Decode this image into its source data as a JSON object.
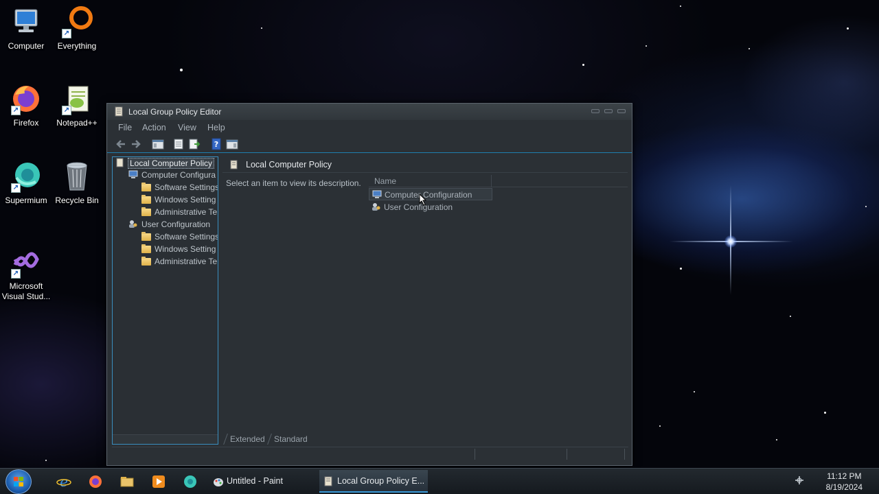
{
  "desktop": {
    "icons": [
      {
        "label": "Computer",
        "icon": "computer-icon"
      },
      {
        "label": "Everything",
        "icon": "everything-search-icon"
      },
      {
        "label": "Firefox",
        "icon": "firefox-icon"
      },
      {
        "label": "Notepad++",
        "icon": "notepadpp-icon"
      },
      {
        "label": "Supermium",
        "icon": "supermium-icon"
      },
      {
        "label": "Recycle Bin",
        "icon": "recycle-bin-icon"
      },
      {
        "label": "Microsoft Visual Stud...",
        "label_line1": "Microsoft",
        "label_line2": "Visual Stud...",
        "icon": "visual-studio-icon"
      }
    ]
  },
  "window": {
    "title": "Local Group Policy Editor",
    "menu": [
      "File",
      "Action",
      "View",
      "Help"
    ],
    "toolbar": [
      "back-arrow-icon",
      "forward-arrow-icon",
      "show-hide-console-tree-icon",
      "properties-icon",
      "export-list-icon",
      "help-icon",
      "show-hide-action-pane-icon"
    ],
    "tree": {
      "root": "Local Computer Policy",
      "computer_config": "Computer Configura",
      "computer_children": [
        "Software Settings",
        "Windows Setting",
        "Administrative Te"
      ],
      "user_config": "User Configuration",
      "user_children": [
        "Software Settings",
        "Windows Setting",
        "Administrative Te"
      ]
    },
    "content": {
      "header": "Local Computer Policy",
      "description": "Select an item to view its description.",
      "column_name": "Name",
      "items": [
        "Computer Configuration",
        "User Configuration"
      ]
    },
    "tabs": [
      "Extended",
      "Standard"
    ]
  },
  "taskbar": {
    "pinned": [
      "internet-explorer-icon",
      "firefox-icon",
      "file-explorer-icon",
      "media-player-icon",
      "supermium-icon"
    ],
    "tasks": [
      {
        "label": "Untitled - Paint",
        "active": false
      },
      {
        "label": "Local Group Policy E...",
        "active": true
      }
    ],
    "clock_time": "11:12 PM",
    "clock_date": "8/19/2024"
  },
  "colors": {
    "accent": "#3a9ad9",
    "window_bg": "#2b3035"
  }
}
